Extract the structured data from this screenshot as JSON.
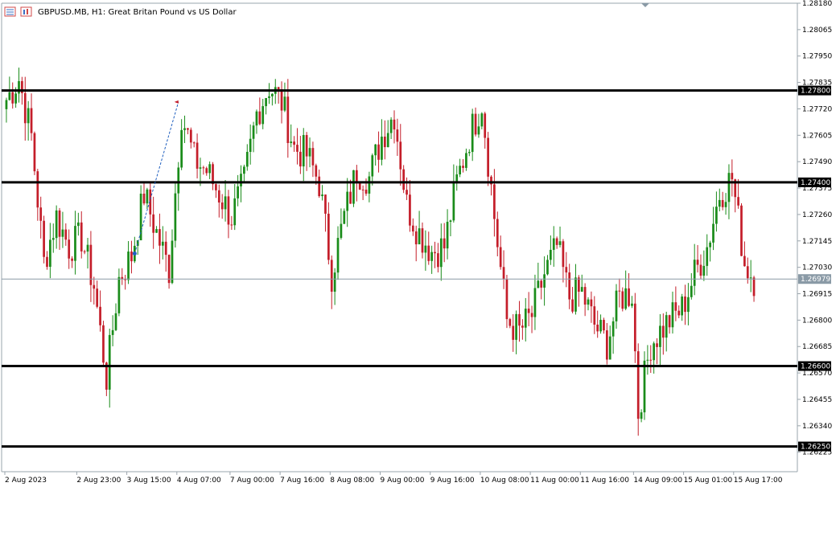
{
  "header": {
    "title": "GBPUSD.MB, H1:  Great Britan Pound vs US Dollar"
  },
  "colors": {
    "bull": "#1a8c1a",
    "bear": "#c41e2a",
    "level": "#000000",
    "current": "#8a9aa6",
    "trendline": "#1f5fbf"
  },
  "chart_data": {
    "type": "candlestick",
    "title": "GBPUSD.MB, H1:  Great Britan Pound vs US Dollar",
    "ylim": [
      1.2614,
      1.2818
    ],
    "y_ticks": [
      "1.28180",
      "1.28065",
      "1.27950",
      "1.27835",
      "1.27720",
      "1.27605",
      "1.27490",
      "1.27375",
      "1.27260",
      "1.27145",
      "1.27030",
      "1.26915",
      "1.26800",
      "1.26685",
      "1.26570",
      "1.26455",
      "1.26340",
      "1.26225"
    ],
    "x_ticks": [
      "2 Aug 2023",
      "2 Aug 23:00",
      "3 Aug 15:00",
      "4 Aug 07:00",
      "7 Aug 00:00",
      "7 Aug 16:00",
      "8 Aug 08:00",
      "9 Aug 00:00",
      "9 Aug 16:00",
      "10 Aug 08:00",
      "11 Aug 00:00",
      "11 Aug 16:00",
      "14 Aug 09:00",
      "15 Aug 01:00",
      "15 Aug 17:00"
    ],
    "levels": [
      {
        "value": 1.278,
        "label": "1.27800"
      },
      {
        "value": 1.274,
        "label": "1.27400"
      },
      {
        "value": 1.266,
        "label": "1.26600"
      },
      {
        "value": 1.2625,
        "label": "1.26250"
      }
    ],
    "current_price": {
      "value": 1.26979,
      "label": "1.26979"
    },
    "trendline": {
      "from": {
        "x": "3 Aug 17:00",
        "y": 1.2709
      },
      "to": {
        "x": "4 Aug 07:00",
        "y": 1.2775
      }
    },
    "anchors": [
      [
        "2 Aug 00:00",
        1.2776
      ],
      [
        "2 Aug 04:00",
        1.2785
      ],
      [
        "2 Aug 08:00",
        1.276
      ],
      [
        "2 Aug 12:00",
        1.2705
      ],
      [
        "2 Aug 16:00",
        1.2725
      ],
      [
        "2 Aug 20:00",
        1.2712
      ],
      [
        "3 Aug 00:00",
        1.2716
      ],
      [
        "3 Aug 04:00",
        1.2695
      ],
      [
        "3 Aug 08:00",
        1.2655
      ],
      [
        "3 Aug 12:00",
        1.2698
      ],
      [
        "3 Aug 16:00",
        1.2708
      ],
      [
        "3 Aug 20:00",
        1.2735
      ],
      [
        "4 Aug 00:00",
        1.2718
      ],
      [
        "4 Aug 04:00",
        1.2702
      ],
      [
        "4 Aug 08:00",
        1.277
      ],
      [
        "4 Aug 12:00",
        1.275
      ],
      [
        "4 Aug 16:00",
        1.2745
      ],
      [
        "7 Aug 00:00",
        1.2725
      ],
      [
        "7 Aug 04:00",
        1.274
      ],
      [
        "7 Aug 08:00",
        1.277
      ],
      [
        "7 Aug 12:00",
        1.2782
      ],
      [
        "7 Aug 16:00",
        1.2775
      ],
      [
        "7 Aug 20:00",
        1.2755
      ],
      [
        "8 Aug 00:00",
        1.2752
      ],
      [
        "8 Aug 04:00",
        1.274
      ],
      [
        "8 Aug 08:00",
        1.27
      ],
      [
        "8 Aug 12:00",
        1.2725
      ],
      [
        "8 Aug 16:00",
        1.2745
      ],
      [
        "8 Aug 20:00",
        1.2742
      ],
      [
        "9 Aug 00:00",
        1.276
      ],
      [
        "9 Aug 04:00",
        1.277
      ],
      [
        "9 Aug 08:00",
        1.273
      ],
      [
        "9 Aug 12:00",
        1.2718
      ],
      [
        "9 Aug 16:00",
        1.271
      ],
      [
        "9 Aug 20:00",
        1.2712
      ],
      [
        "10 Aug 00:00",
        1.274
      ],
      [
        "10 Aug 04:00",
        1.276
      ],
      [
        "10 Aug 08:00",
        1.2775
      ],
      [
        "10 Aug 12:00",
        1.2725
      ],
      [
        "10 Aug 16:00",
        1.268
      ],
      [
        "10 Aug 20:00",
        1.2675
      ],
      [
        "11 Aug 00:00",
        1.2682
      ],
      [
        "11 Aug 04:00",
        1.27
      ],
      [
        "11 Aug 08:00",
        1.2712
      ],
      [
        "11 Aug 12:00",
        1.269
      ],
      [
        "11 Aug 16:00",
        1.2692
      ],
      [
        "11 Aug 20:00",
        1.2678
      ],
      [
        "14 Aug 00:00",
        1.267
      ],
      [
        "14 Aug 04:00",
        1.269
      ],
      [
        "14 Aug 08:00",
        1.2692
      ],
      [
        "14 Aug 10:00",
        1.264
      ],
      [
        "14 Aug 14:00",
        1.267
      ],
      [
        "14 Aug 20:00",
        1.268
      ],
      [
        "15 Aug 00:00",
        1.2685
      ],
      [
        "15 Aug 04:00",
        1.27
      ],
      [
        "15 Aug 08:00",
        1.2712
      ],
      [
        "15 Aug 12:00",
        1.2735
      ],
      [
        "15 Aug 16:00",
        1.2742
      ],
      [
        "15 Aug 20:00",
        1.2705
      ],
      [
        "15 Aug 23:00",
        1.2698
      ]
    ]
  }
}
